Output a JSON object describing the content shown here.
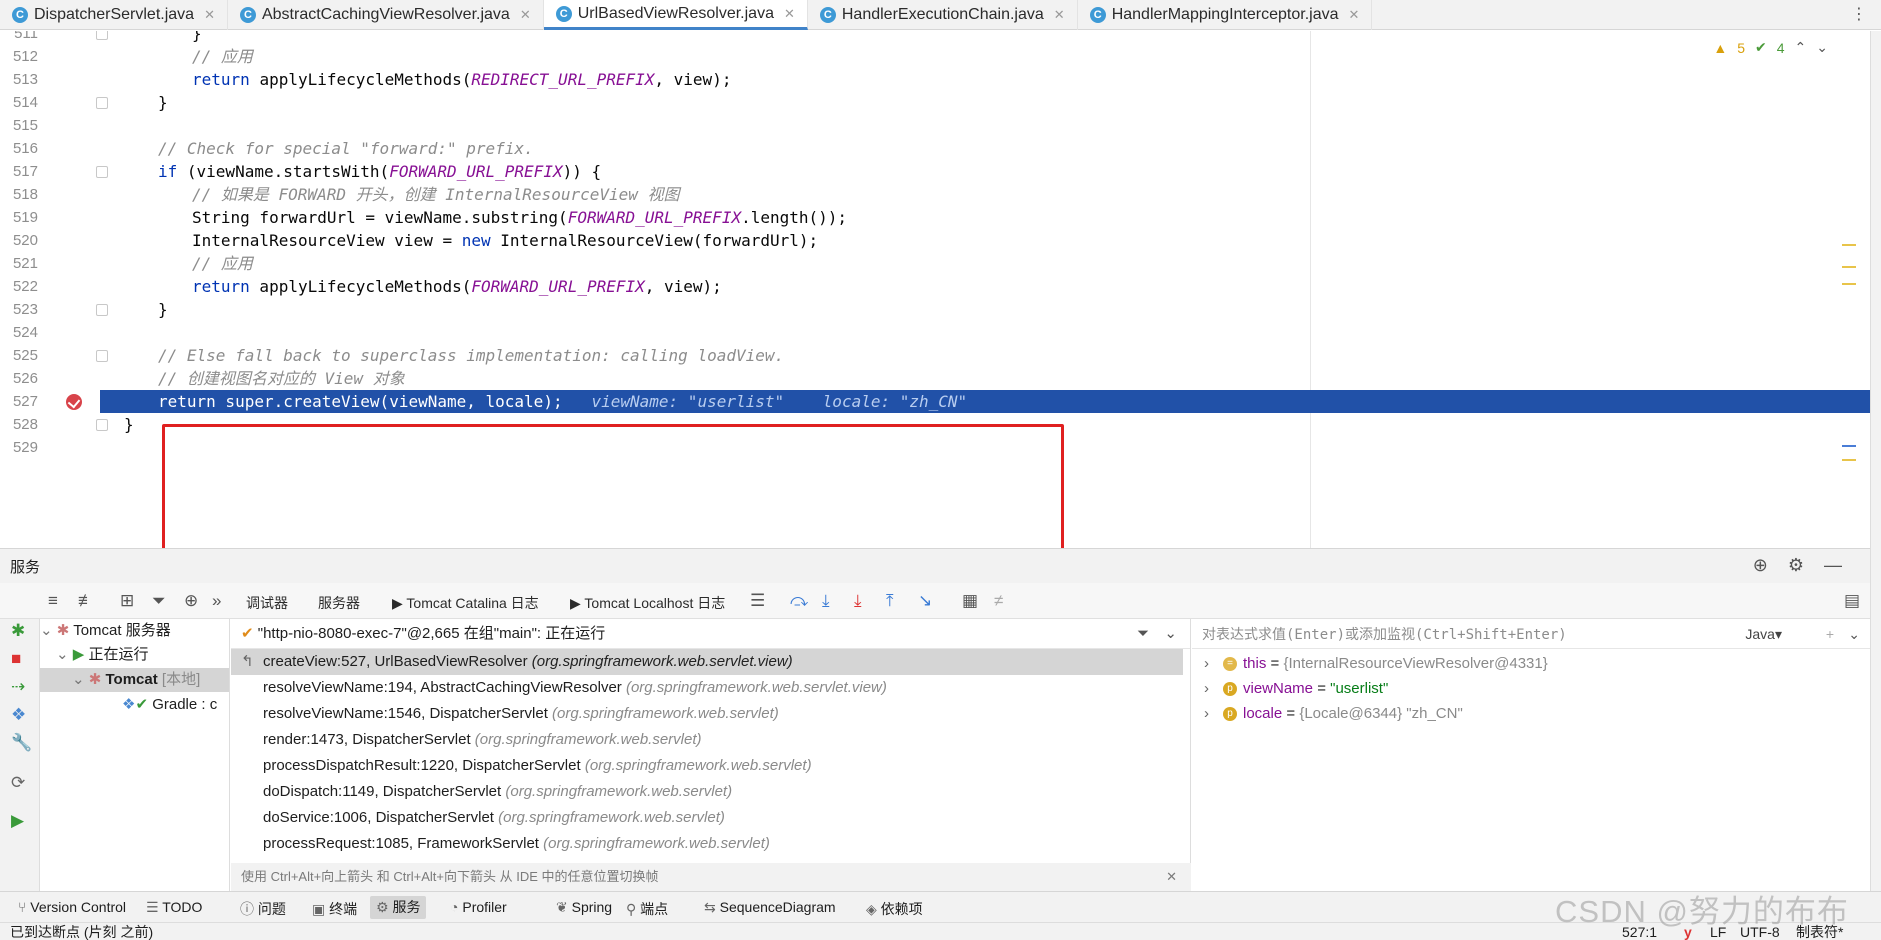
{
  "tabs": [
    {
      "label": "DispatcherServlet.java",
      "active": false
    },
    {
      "label": "AbstractCachingViewResolver.java",
      "active": false
    },
    {
      "label": "UrlBasedViewResolver.java",
      "active": true
    },
    {
      "label": "HandlerExecutionChain.java",
      "active": false
    },
    {
      "label": "HandlerMappingInterceptor.java",
      "active": false
    }
  ],
  "editor": {
    "indicators": {
      "warnings": "5",
      "checks": "4"
    },
    "lines": [
      {
        "num": "511",
        "text": "}"
      },
      {
        "num": "512",
        "text": "// 应用"
      },
      {
        "num": "513",
        "pre": "return ",
        "const": "REDIRECT_URL_PREFIX",
        "mid": "applyLifecycleMethods(",
        "post": ", view);"
      },
      {
        "num": "514",
        "text": "}"
      },
      {
        "num": "515",
        "text": ""
      },
      {
        "num": "516",
        "text": "// Check for special \"forward:\" prefix."
      },
      {
        "num": "517",
        "kw": "if",
        "mid": " (viewName.startsWith(",
        "const": "FORWARD_URL_PREFIX",
        "post": ")) {"
      },
      {
        "num": "518",
        "text": "// 如果是 FORWARD 开头，创建 InternalResourceView 视图"
      },
      {
        "num": "519",
        "pre": "String forwardUrl = viewName.substring(",
        "const": "FORWARD_URL_PREFIX",
        "post": ".length());"
      },
      {
        "num": "520",
        "pre": "InternalResourceView view = ",
        "kw": "new",
        "post": " InternalResourceView(forwardUrl);"
      },
      {
        "num": "521",
        "text": "// 应用"
      },
      {
        "num": "522",
        "kw": "return",
        "mid": " applyLifecycleMethods(",
        "const": "FORWARD_URL_PREFIX",
        "post": ", view);"
      },
      {
        "num": "523",
        "text": "}"
      },
      {
        "num": "524",
        "text": ""
      },
      {
        "num": "525",
        "text": "// Else fall back to superclass implementation: calling loadView."
      },
      {
        "num": "526",
        "text": "// 创建视图名对应的 View 对象"
      },
      {
        "num": "527",
        "text": "return super.createView(viewName, locale);",
        "hint1": "viewName: \"userlist\"",
        "hint2": "locale: \"zh_CN\""
      },
      {
        "num": "528",
        "text": "}"
      },
      {
        "num": "529",
        "text": ""
      }
    ]
  },
  "services": {
    "title": "服务",
    "debug_tabs": [
      "调试器",
      "服务器",
      "Tomcat Catalina 日志",
      "Tomcat Localhost 日志"
    ],
    "tree": {
      "root": "Tomcat 服务器",
      "running": "正在运行",
      "tomcat": "Tomcat",
      "tomcat_tag": "[本地]",
      "gradle": "Gradle : c"
    },
    "thread": "\"http-nio-8080-exec-7\"@2,665 在组\"main\": 正在运行",
    "frames": [
      {
        "method": "createView:527, UrlBasedViewResolver",
        "pkg": "(org.springframework.web.servlet.view)"
      },
      {
        "method": "resolveViewName:194, AbstractCachingViewResolver",
        "pkg": "(org.springframework.web.servlet.view)"
      },
      {
        "method": "resolveViewName:1546, DispatcherServlet",
        "pkg": "(org.springframework.web.servlet)"
      },
      {
        "method": "render:1473, DispatcherServlet",
        "pkg": "(org.springframework.web.servlet)"
      },
      {
        "method": "processDispatchResult:1220, DispatcherServlet",
        "pkg": "(org.springframework.web.servlet)"
      },
      {
        "method": "doDispatch:1149, DispatcherServlet",
        "pkg": "(org.springframework.web.servlet)"
      },
      {
        "method": "doService:1006, DispatcherServlet",
        "pkg": "(org.springframework.web.servlet)"
      },
      {
        "method": "processRequest:1085, FrameworkServlet",
        "pkg": "(org.springframework.web.servlet)"
      }
    ],
    "frames_hint": "使用 Ctrl+Alt+向上箭头 和 Ctrl+Alt+向下箭头 从 IDE 中的任意位置切换帧",
    "eval_placeholder": "对表达式求值(Enter)或添加监视(Ctrl+Shift+Enter)",
    "lang": "Java",
    "variables": [
      {
        "name": "this",
        "value": "{InternalResourceViewResolver@4331}",
        "badge": "="
      },
      {
        "name": "viewName",
        "value": "\"userlist\"",
        "badge": "p"
      },
      {
        "name": "locale",
        "value": "{Locale@6344} \"zh_CN\"",
        "badge": "p"
      }
    ]
  },
  "toolwindows": [
    "Version Control",
    "TODO",
    "问题",
    "终端",
    "服务",
    "Profiler",
    "Spring",
    "端点",
    "SequenceDiagram",
    "依赖项"
  ],
  "status": {
    "message": "已到达断点 (片刻 之前)",
    "position": "527:1",
    "line_sep": "LF",
    "encoding": "UTF-8",
    "indent": "制表符*"
  },
  "watermark": "CSDN @努力的布布"
}
